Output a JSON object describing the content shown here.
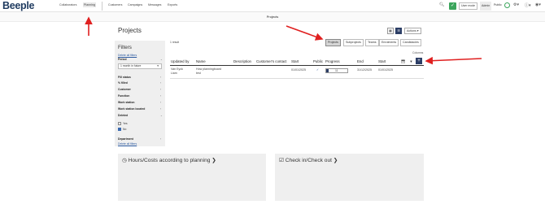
{
  "app": {
    "logo": "Beeple"
  },
  "nav": {
    "left": [
      "Collaborators",
      "Planning"
    ],
    "right": [
      "Customers",
      "Campaigns",
      "Messages",
      "Exports"
    ],
    "active": "Planning"
  },
  "topbar": {
    "user_mode_label": "User mode",
    "admin_label": "Admin",
    "public_label": "Public",
    "icons": [
      "search-icon",
      "user-mode-check-icon",
      "status-ring-icon",
      "gear-icon",
      "help-icon",
      "account-icon"
    ]
  },
  "subbar": {
    "title": "Projects"
  },
  "page": {
    "title": "Projects",
    "actions_label": "Actions ▾"
  },
  "filters": {
    "title": "Filters",
    "delete_all_top": "Delete all filters",
    "period_label": "Period",
    "period_value": "1 month in future",
    "groups": [
      "Fill status",
      "% filled",
      "Customer",
      "Function",
      "Work station",
      "Work station located"
    ],
    "deleted_label": "Deleted",
    "deleted_options": [
      {
        "label": "Yes",
        "checked": false
      },
      {
        "label": "No",
        "checked": true
      }
    ],
    "department_label": "Department",
    "delete_all_bottom": "Delete all filters"
  },
  "tabs": [
    {
      "label": "Projects",
      "active": true
    },
    {
      "label": "Subprojects",
      "active": false
    },
    {
      "label": "Teams",
      "active": false
    },
    {
      "label": "Enrolments",
      "active": false
    },
    {
      "label": "Candidacies",
      "active": false
    }
  ],
  "results": {
    "count_label": "1 result",
    "columns_label": "Columns"
  },
  "table": {
    "headers": [
      "Updated by",
      "Name",
      "Description",
      "Customer's contact",
      "Start",
      "Public",
      "Progress",
      "End",
      "Start"
    ],
    "rows": [
      {
        "updated_by": "Van Eyck\nLiam",
        "name": "How planningboard\ntest",
        "description": "",
        "contact": "",
        "start": "01/01/2025",
        "public": "✓",
        "progress_value": 0.1,
        "progress_text": "11",
        "end": "31/12/2025",
        "start2": "01/01/2025"
      }
    ]
  },
  "cards": [
    {
      "title": "Hours/Costs according to planning ❯"
    },
    {
      "title": "Check in/Check out ❯"
    }
  ],
  "colors": {
    "accent": "#2c3e66",
    "annotation": "#e02020",
    "success": "#3ba55c"
  }
}
